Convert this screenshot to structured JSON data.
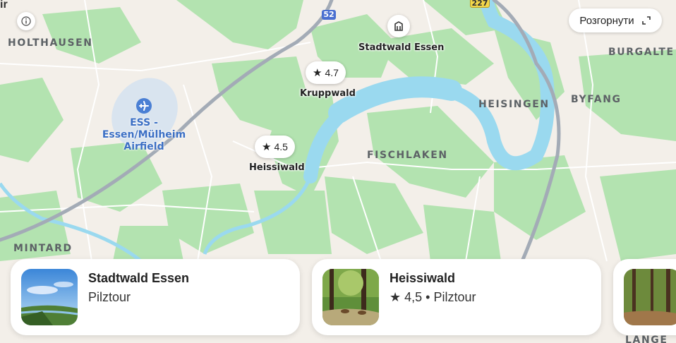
{
  "map": {
    "districts": [
      "HOLTHAUSEN",
      "BURGALTE",
      "BYFANG",
      "HEISINGEN",
      "FISCHLAKEN",
      "MINTARD",
      "LANGE"
    ],
    "airport": [
      "ESS -",
      "Essen/Mülheim",
      "Airfield"
    ],
    "poi_labels": [
      "Stadtwald Essen",
      "Kruppwald",
      "Heissiwald"
    ],
    "road_shields": [
      "52",
      "227"
    ],
    "corner_text": "ir"
  },
  "pins": [
    {
      "rating": "4.7",
      "icon": "star-icon"
    },
    {
      "rating": "4.5",
      "icon": "star-icon"
    }
  ],
  "controls": {
    "expand_label": "Розгорнути",
    "info_icon": "info-icon",
    "expand_icon": "expand-icon",
    "building_icon": "building-icon"
  },
  "cards": [
    {
      "title": "Stadtwald Essen",
      "subtitle": "Pilztour"
    },
    {
      "title": "Heissiwald",
      "rating": "4,5",
      "separator": "•",
      "subtitle": "Pilztour"
    }
  ],
  "colors": {
    "forest": "#a3dfa3",
    "water": "#9ad9ef",
    "motorway": "#a3abb6",
    "airport_text": "#3b6fc4"
  }
}
